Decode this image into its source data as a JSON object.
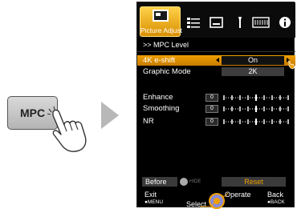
{
  "remote": {
    "button_label": "MPC"
  },
  "osd": {
    "tabs": [
      {
        "label": "Picture Adjust",
        "icon": "picture-icon",
        "active": true
      },
      {
        "icon": "input-settings-icon"
      },
      {
        "icon": "display-settings-icon"
      },
      {
        "icon": "installation-icon"
      },
      {
        "icon": "function-icon"
      },
      {
        "icon": "information-icon"
      }
    ],
    "breadcrumb": ">> MPC Level",
    "rows": [
      {
        "label": "4K e-shift",
        "value": "On",
        "selected": true
      },
      {
        "label": "Graphic Mode",
        "value": "2K",
        "selected": false
      }
    ],
    "sliders": [
      {
        "label": "Enhance",
        "value": "0"
      },
      {
        "label": "Smoothing",
        "value": "0"
      },
      {
        "label": "NR",
        "value": "0"
      }
    ],
    "before_label": "Before",
    "hide_label": "HIDE",
    "reset_label": "Reset",
    "footer": {
      "exit": "Exit",
      "menu": "●MENU",
      "select": "Select",
      "operate": "Operate",
      "back": "Back",
      "back_small": "●BACK"
    }
  },
  "colors": {
    "accent": "#f0a000",
    "osd_background": "#000000"
  }
}
